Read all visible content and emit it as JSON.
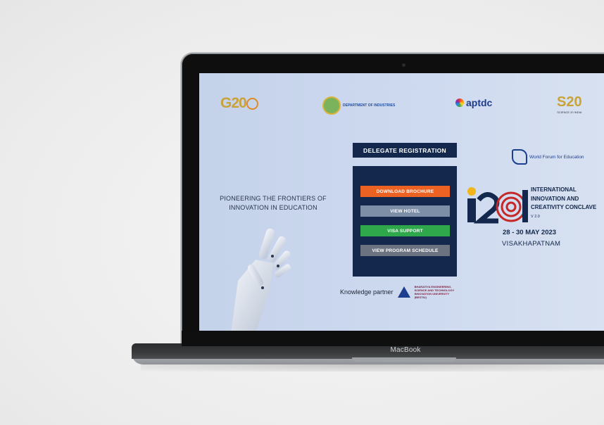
{
  "device": {
    "brand_label": "MacBook"
  },
  "logos": {
    "g20": {
      "text": "G20",
      "sub": ""
    },
    "industries": {
      "text": "DEPARTMENT OF INDUSTRIES"
    },
    "aptdc": {
      "text": "aptdc"
    },
    "s20": {
      "text": "S20",
      "sub": "SCIENCE 20 INDIA"
    },
    "wfe": {
      "abbr": "WFE",
      "text": "World Forum for Education"
    }
  },
  "hero": {
    "tagline_line1": "PIONEERING THE FRONTIERS OF",
    "tagline_line2": "INNOVATION IN EDUCATION"
  },
  "registration": {
    "title": "DELEGATE REGISTRATION",
    "buttons": [
      {
        "label": "DOWNLOAD BROCHURE",
        "color": "#ec6223"
      },
      {
        "label": "VIEW HOTEL",
        "color": "#7d8ea7"
      },
      {
        "label": "VISA SUPPORT",
        "color": "#2fa84c"
      },
      {
        "label": "VIEW PROGRAM SCHEDULE",
        "color": "#6b7280"
      }
    ]
  },
  "knowledge_partner": {
    "label": "Knowledge partner",
    "partner_name": "BHARATIYA ENGINEERING, SCIENCE AND TECHNOLOGY INNOVATION UNIVERSITY (BESTIU)"
  },
  "event": {
    "logo_text": "i2CI",
    "title_line1": "INTERNATIONAL",
    "title_line2": "INNOVATION AND",
    "title_line3": "CREATIVITY CONCLAVE",
    "version": "V 2.0",
    "dates": "28 - 30 MAY 2023",
    "city": "VISAKHAPATNAM"
  },
  "colors": {
    "navy": "#13284c",
    "screen_bg": "#c9d6ee"
  }
}
